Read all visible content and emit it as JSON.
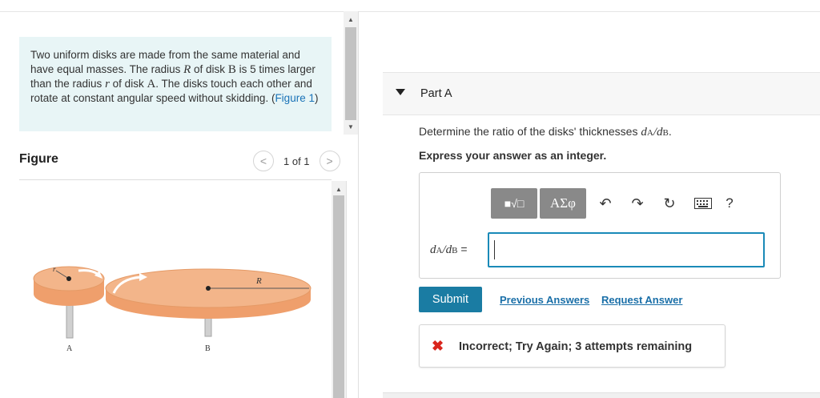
{
  "problem": {
    "line_a": "Two uniform disks are made from the same material and have equal masses. The radius ",
    "var_R": "R",
    "line_b": " of disk ",
    "disk_B": "B",
    "line_c": " is 5 times larger than the radius ",
    "var_r": "r",
    "line_d": " of disk ",
    "disk_A": "A",
    "line_e": ". The disks touch each other and rotate at constant angular speed without skidding. (",
    "figure_link": "Figure 1",
    "line_f": ")"
  },
  "figure": {
    "heading": "Figure",
    "pager_text": "1 of 1",
    "prev_glyph": "<",
    "next_glyph": ">",
    "label_A": "A",
    "label_B": "B",
    "label_R": "R",
    "label_r": "r"
  },
  "part": {
    "title": "Part A",
    "question_prefix": "Determine the ratio of the disks' thicknesses ",
    "d": "d",
    "sub_A": "A",
    "slash": "/",
    "sub_B": "B",
    "question_suffix": ".",
    "instruction": "Express your answer as an integer.",
    "answer_equals": " ="
  },
  "toolbar": {
    "templates_label": "■√□",
    "symbols_label": "ΑΣφ",
    "undo_glyph": "↶",
    "redo_glyph": "↷",
    "reset_glyph": "↻",
    "help_label": "?"
  },
  "actions": {
    "submit": "Submit",
    "previous_answers": "Previous Answers",
    "request_answer": "Request Answer"
  },
  "feedback": {
    "icon": "✖",
    "message": "Incorrect; Try Again; 3 attempts remaining"
  },
  "colors": {
    "problem_bg": "#e8f5f6",
    "link": "#1a6fa8",
    "submit_bg": "#1a7ca3",
    "error": "#d9251c",
    "input_border": "#1a8ab8",
    "disk_fill": "#f3b58a"
  }
}
